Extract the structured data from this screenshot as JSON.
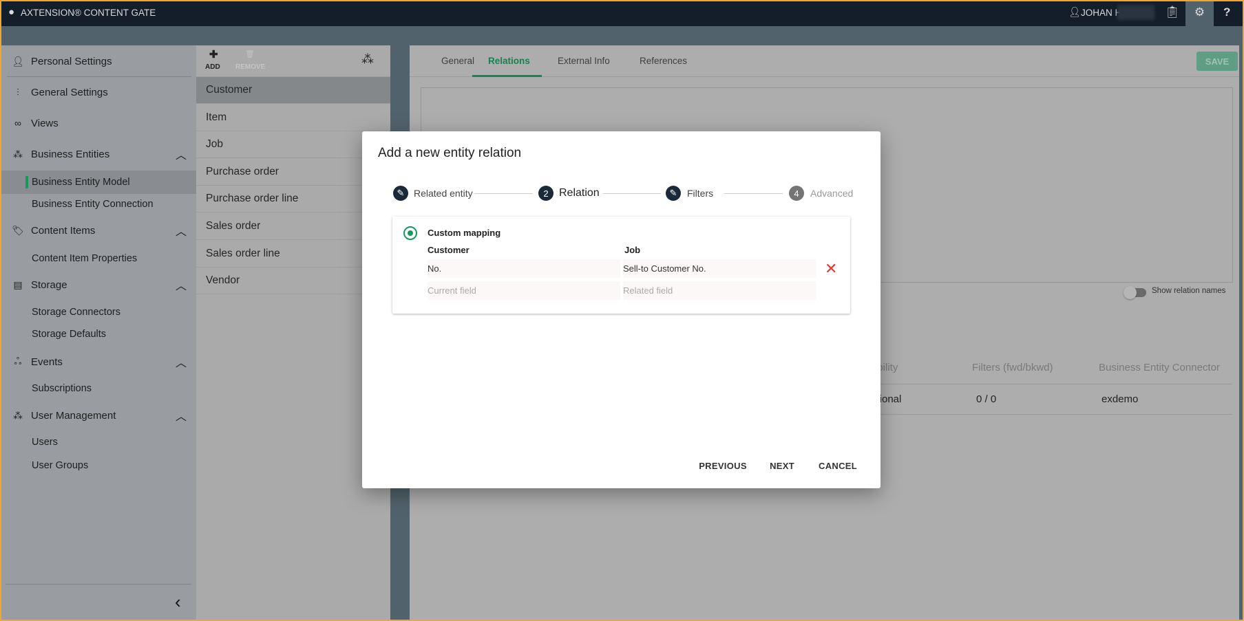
{
  "app": {
    "title": "AXTENSION® CONTENT GATE",
    "user": "JOHAN H"
  },
  "sidebar": {
    "items": [
      {
        "label": "Personal Settings",
        "icon": "person-icon"
      },
      {
        "label": "General Settings",
        "icon": "sliders-icon"
      },
      {
        "label": "Views",
        "icon": "glasses-icon"
      },
      {
        "label": "Business Entities",
        "icon": "entities-icon"
      },
      {
        "label": "Business Entity Model"
      },
      {
        "label": "Business Entity Connection"
      },
      {
        "label": "Content Items",
        "icon": "tag-icon"
      },
      {
        "label": "Content Item Properties"
      },
      {
        "label": "Storage",
        "icon": "archive-icon"
      },
      {
        "label": "Storage Connectors"
      },
      {
        "label": "Storage Defaults"
      },
      {
        "label": "Events",
        "icon": "webhook-icon"
      },
      {
        "label": "Subscriptions"
      },
      {
        "label": "User Management",
        "icon": "users-icon"
      },
      {
        "label": "Users"
      },
      {
        "label": "User Groups"
      }
    ]
  },
  "list": {
    "add": "ADD",
    "remove": "REMOVE",
    "items": [
      "Customer",
      "Item",
      "Job",
      "Purchase order",
      "Purchase order line",
      "Sales order",
      "Sales order line",
      "Vendor"
    ]
  },
  "main": {
    "tabs": [
      "General",
      "Relations",
      "External Info",
      "References"
    ],
    "save": "SAVE",
    "diagram_fragment": "er",
    "toggle_label": "Show relation names",
    "table": {
      "headers": [
        "ability",
        "Filters (fwd/bkwd)",
        "Business Entity Connector"
      ],
      "row": [
        "ctional",
        "0 / 0",
        "exdemo"
      ]
    }
  },
  "dialog": {
    "title": "Add a new entity relation",
    "steps": [
      {
        "label": "Related entity",
        "icon": "pencil"
      },
      {
        "label": "Relation",
        "num": "2"
      },
      {
        "label": "Filters",
        "icon": "pencil"
      },
      {
        "label": "Advanced",
        "num": "4"
      }
    ],
    "mapping_label": "Custom mapping",
    "col_current": "Customer",
    "col_related": "Job",
    "row": {
      "current": "No.",
      "related": "Sell-to Customer No."
    },
    "placeholder_current": "Current field",
    "placeholder_related": "Related field",
    "buttons": {
      "previous": "PREVIOUS",
      "next": "NEXT",
      "cancel": "CANCEL"
    }
  },
  "colors": {
    "accent": "#149a5c",
    "topbar": "#141e2a",
    "delete": "#e53935"
  }
}
